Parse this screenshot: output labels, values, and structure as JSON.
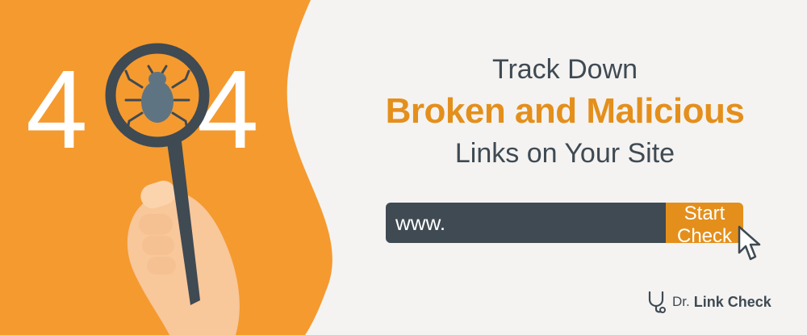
{
  "hero": {
    "error_code": "404",
    "headline_top": "Track Down",
    "headline_main": "Broken and Malicious",
    "headline_bottom": "Links on Your Site"
  },
  "search": {
    "input_value": "www.",
    "button_label": "Start Check"
  },
  "brand": {
    "prefix": "Dr.",
    "name": "Link Check",
    "icon": "stethoscope-icon"
  },
  "colors": {
    "accent_orange": "#e48f1c",
    "panel_orange": "#f59a2f",
    "dark_slate": "#3f4a53",
    "background": "#f4f3f1"
  }
}
